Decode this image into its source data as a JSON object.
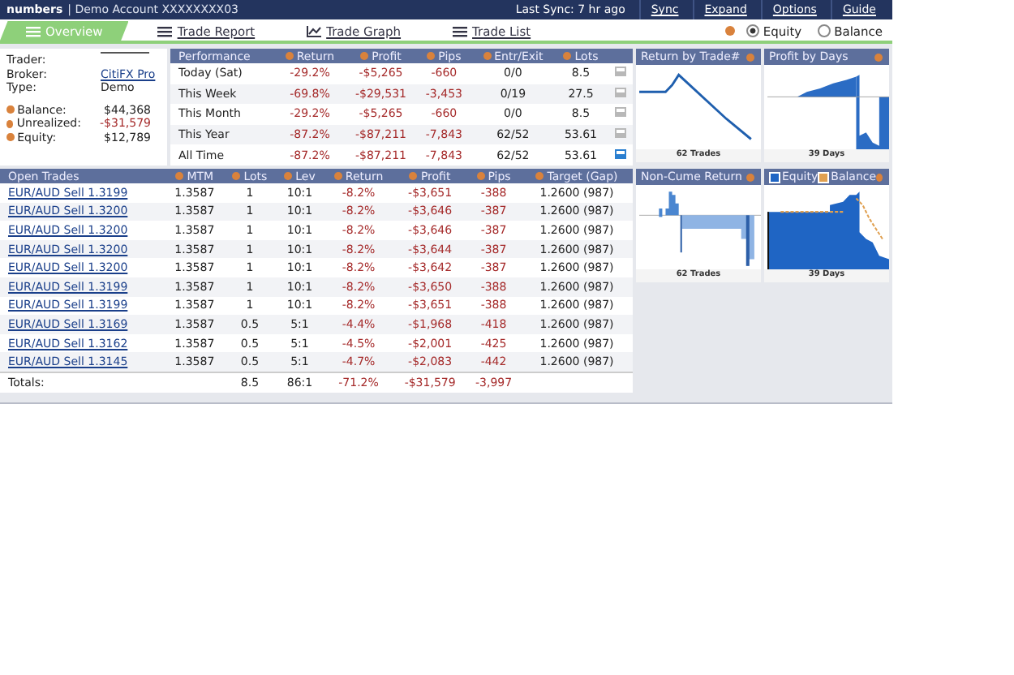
{
  "header": {
    "brand": "numbers",
    "account": "| Demo Account XXXXXXXX03",
    "sync": "Last Sync: 7 hr ago",
    "links": [
      "Sync",
      "Expand",
      "Options",
      "Guide"
    ]
  },
  "tabs": [
    {
      "label": "Overview",
      "selected": true
    },
    {
      "label": "Trade Report",
      "selected": false
    },
    {
      "label": "Trade Graph",
      "selected": false
    },
    {
      "label": "Trade List",
      "selected": false
    }
  ],
  "view_options": [
    {
      "label": "Equity",
      "selected": true
    },
    {
      "label": "Balance",
      "selected": false
    }
  ],
  "account": [
    {
      "label": "Trader:",
      "kind": "blank"
    },
    {
      "label": "Broker:",
      "value": "CitiFX Pro",
      "kind": "link"
    },
    {
      "label": "Type:",
      "value": "Demo",
      "kind": "text"
    },
    {
      "label": "Balance:",
      "value": "$44,368",
      "kind": "money"
    },
    {
      "label": "Unrealized:",
      "value": "-$31,579",
      "kind": "money"
    },
    {
      "label": "Equity:",
      "value": "$12,789",
      "kind": "money"
    }
  ],
  "performance": {
    "columns": [
      "Performance",
      "Return",
      "Profit",
      "Pips",
      "Entr/Exit",
      "Lots"
    ],
    "rows": [
      {
        "cells": [
          "Today (Sat)",
          "-29.2%",
          "-$5,265",
          "-660",
          "0/0",
          "8.5"
        ],
        "selected": false
      },
      {
        "cells": [
          "This Week",
          "-69.8%",
          "-$29,531",
          "-3,453",
          "0/19",
          "27.5"
        ],
        "selected": false
      },
      {
        "cells": [
          "This Month",
          "-29.2%",
          "-$5,265",
          "-660",
          "0/0",
          "8.5"
        ],
        "selected": false
      },
      {
        "cells": [
          "This Year",
          "-87.2%",
          "-$87,211",
          "-7,843",
          "62/52",
          "53.61"
        ],
        "selected": false
      },
      {
        "cells": [
          "All Time",
          "-87.2%",
          "-$87,211",
          "-7,843",
          "62/52",
          "53.61"
        ],
        "selected": true
      }
    ]
  },
  "charts": [
    {
      "kind": "line",
      "title": "Return by Trade#",
      "footer": "62 Trades"
    },
    {
      "kind": "area",
      "title": "Profit by Days",
      "footer": "39 Days"
    },
    {
      "kind": "bars",
      "title": "Non-Cume Return",
      "footer": "62 Trades"
    },
    {
      "kind": "equity",
      "legend": [
        "Equity",
        "Balance"
      ],
      "footer": "39 Days"
    }
  ],
  "open_trades": {
    "columns": [
      "Open Trades",
      "MTM",
      "Lots",
      "Lev",
      "Return",
      "Profit",
      "Pips",
      "Target (Gap)"
    ],
    "rows": [
      [
        "EUR/AUD Sell 1.3199",
        "1.3587",
        "1",
        "10:1",
        "-8.2%",
        "-$3,651",
        "-388",
        "1.2600 (987)"
      ],
      [
        "EUR/AUD Sell 1.3200",
        "1.3587",
        "1",
        "10:1",
        "-8.2%",
        "-$3,646",
        "-387",
        "1.2600 (987)"
      ],
      [
        "EUR/AUD Sell 1.3200",
        "1.3587",
        "1",
        "10:1",
        "-8.2%",
        "-$3,646",
        "-387",
        "1.2600 (987)"
      ],
      [
        "EUR/AUD Sell 1.3200",
        "1.3587",
        "1",
        "10:1",
        "-8.2%",
        "-$3,644",
        "-387",
        "1.2600 (987)"
      ],
      [
        "EUR/AUD Sell 1.3200",
        "1.3587",
        "1",
        "10:1",
        "-8.2%",
        "-$3,642",
        "-387",
        "1.2600 (987)"
      ],
      [
        "EUR/AUD Sell 1.3199",
        "1.3587",
        "1",
        "10:1",
        "-8.2%",
        "-$3,650",
        "-388",
        "1.2600 (987)"
      ],
      [
        "EUR/AUD Sell 1.3199",
        "1.3587",
        "1",
        "10:1",
        "-8.2%",
        "-$3,651",
        "-388",
        "1.2600 (987)"
      ],
      [
        "EUR/AUD Sell 1.3169",
        "1.3587",
        "0.5",
        "5:1",
        "-4.4%",
        "-$1,968",
        "-418",
        "1.2600 (987)"
      ],
      [
        "EUR/AUD Sell 1.3162",
        "1.3587",
        "0.5",
        "5:1",
        "-4.5%",
        "-$2,001",
        "-425",
        "1.2600 (987)"
      ],
      [
        "EUR/AUD Sell 1.3145",
        "1.3587",
        "0.5",
        "5:1",
        "-4.7%",
        "-$2,083",
        "-442",
        "1.2600 (987)"
      ]
    ],
    "totals": {
      "label": "Totals:",
      "lots": "8.5",
      "lev": "86:1",
      "return": "-71.2%",
      "profit": "-$31,579",
      "pips": "-3,997"
    }
  }
}
